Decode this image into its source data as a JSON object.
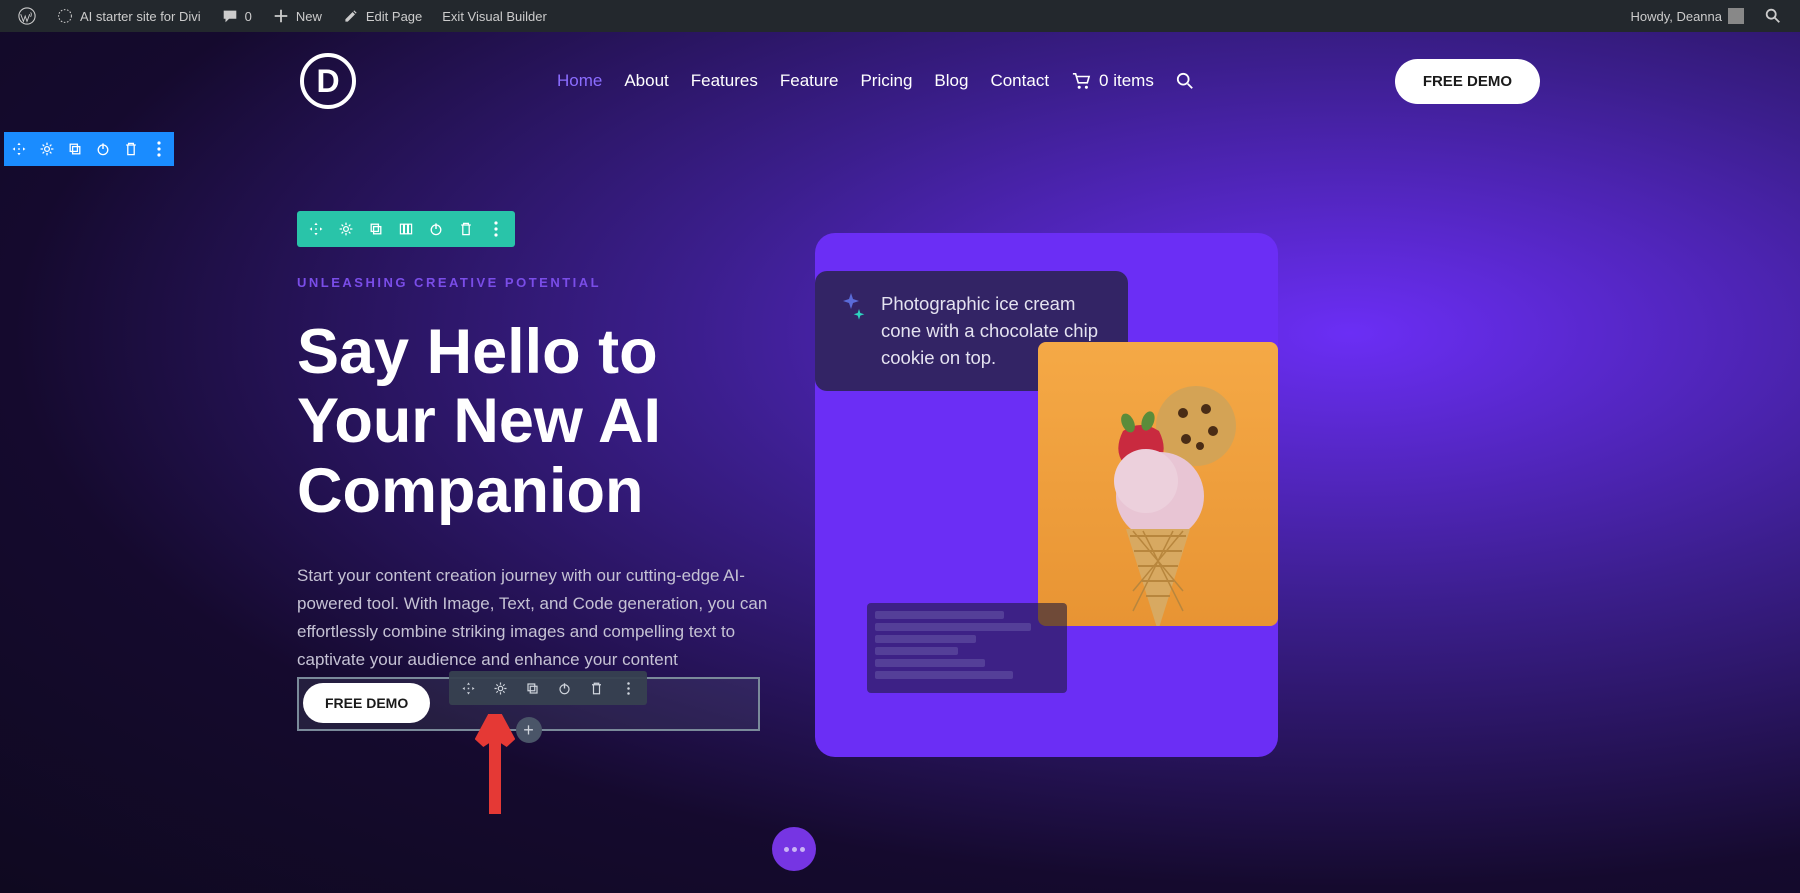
{
  "adminbar": {
    "site_name": "AI starter site for Divi",
    "comments": "0",
    "new_label": "New",
    "edit_page": "Edit Page",
    "exit_vb": "Exit Visual Builder",
    "greeting": "Howdy, Deanna"
  },
  "header": {
    "logo_letter": "D",
    "nav": [
      "Home",
      "About",
      "Features",
      "Feature",
      "Pricing",
      "Blog",
      "Contact"
    ],
    "active_index": 0,
    "cart_text": "0 items",
    "cta": "FREE DEMO"
  },
  "hero": {
    "kicker": "UNLEASHING CREATIVE POTENTIAL",
    "title": "Say Hello to Your New AI Companion",
    "body": "Start your content creation journey with our cutting-edge AI-powered tool. With Image, Text, and Code generation, you can effortlessly combine striking images and compelling text to captivate your audience and enhance your content",
    "cta": "FREE DEMO"
  },
  "prompt_card": {
    "text": "Photographic ice cream cone with a chocolate chip cookie on top."
  },
  "toolbar_icons": {
    "section": [
      "move-icon",
      "gear-icon",
      "duplicate-icon",
      "power-icon",
      "trash-icon",
      "more-icon"
    ],
    "row": [
      "move-icon",
      "gear-icon",
      "duplicate-icon",
      "columns-icon",
      "power-icon",
      "trash-icon",
      "more-icon"
    ],
    "module": [
      "move-icon",
      "gear-icon",
      "duplicate-icon",
      "power-icon",
      "trash-icon",
      "more-icon"
    ]
  }
}
